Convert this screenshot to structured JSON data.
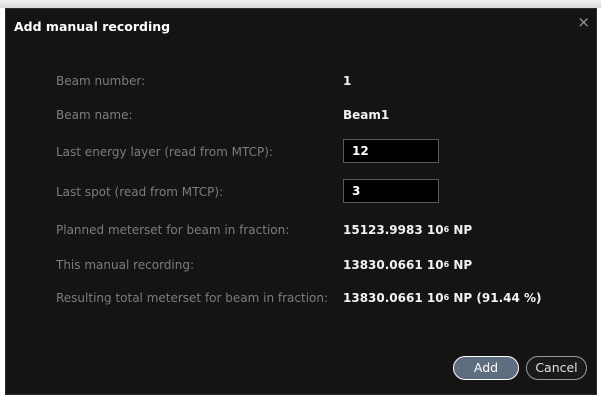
{
  "dialog": {
    "title": "Add manual recording",
    "close_glyph": "×"
  },
  "fields": {
    "beam_number": {
      "label": "Beam number:",
      "value": "1"
    },
    "beam_name": {
      "label": "Beam name:",
      "value": "Beam1"
    },
    "last_energy_layer": {
      "label": "Last energy layer (read from MTCP):",
      "value": "12"
    },
    "last_spot": {
      "label": "Last spot (read from MTCP):",
      "value": "3"
    },
    "planned_meterset": {
      "label": "Planned meterset for beam in fraction:",
      "number": "15123.9983",
      "unit_base": "10",
      "unit_exp": "6",
      "unit_suffix": "NP"
    },
    "this_recording": {
      "label": "This manual recording:",
      "number": "13830.0661",
      "unit_base": "10",
      "unit_exp": "6",
      "unit_suffix": "NP"
    },
    "resulting_total": {
      "label": "Resulting total meterset for beam in fraction:",
      "number": "13830.0661",
      "unit_base": "10",
      "unit_exp": "6",
      "unit_suffix": "NP (91.44 %)"
    }
  },
  "buttons": {
    "add": "Add",
    "cancel": "Cancel"
  }
}
